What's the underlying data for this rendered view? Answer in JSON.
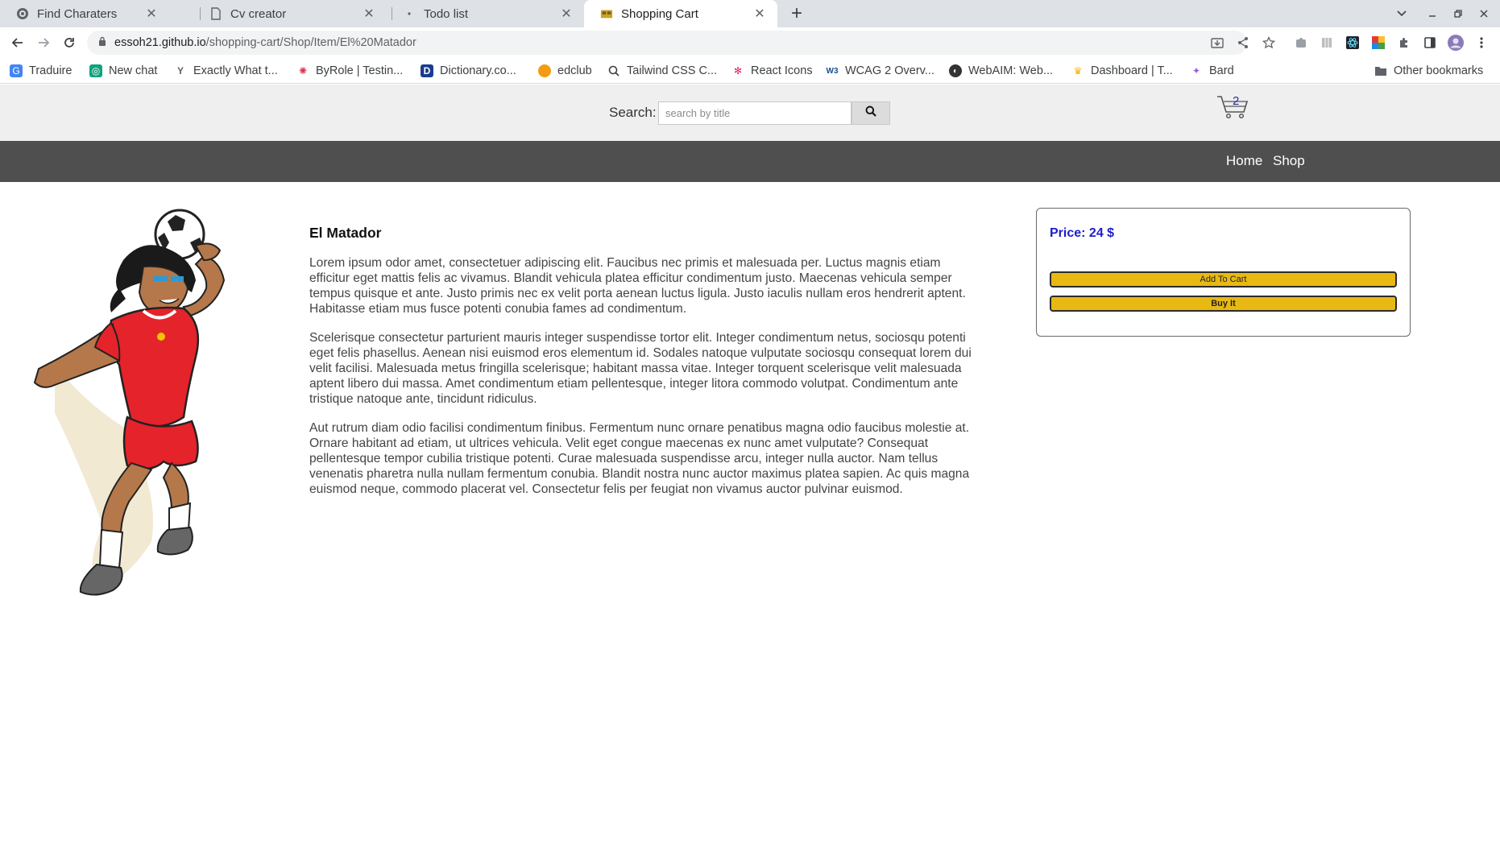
{
  "browser": {
    "tabs": [
      {
        "title": "Find Charaters",
        "icon": "globe-icon",
        "active": false
      },
      {
        "title": "Cv creator",
        "icon": "document-icon",
        "active": false
      },
      {
        "title": "Todo list",
        "icon": "dot-icon",
        "active": false
      },
      {
        "title": "Shopping Cart",
        "icon": "cart-favicon",
        "active": true
      }
    ],
    "url": {
      "host": "essoh21.github.io",
      "path": "/shopping-cart/Shop/Item/El%20Matador"
    },
    "bookmarks": [
      {
        "label": "Traduire",
        "icon": "translate-icon",
        "color": "#4285f4"
      },
      {
        "label": "New chat",
        "icon": "chat-icon",
        "color": "#10a37f"
      },
      {
        "label": "Exactly What t...",
        "icon": "y-icon",
        "color": "#5f6368"
      },
      {
        "label": "ByRole | Testin...",
        "icon": "octopus-icon",
        "color": "#e2334f"
      },
      {
        "label": "Dictionary.co...",
        "icon": "d-icon",
        "color": "#1a3c8f"
      },
      {
        "label": "edclub",
        "icon": "orange-icon",
        "color": "#f39c12"
      },
      {
        "label": "Tailwind CSS C...",
        "icon": "search-icon",
        "color": "#5f6368"
      },
      {
        "label": "React Icons",
        "icon": "react-icon",
        "color": "#e91e63"
      },
      {
        "label": "WCAG 2 Overv...",
        "icon": "w3c-icon",
        "color": "#1a4f8b"
      },
      {
        "label": "WebAIM: Web...",
        "icon": "webaim-icon",
        "color": "#333333"
      },
      {
        "label": "Dashboard | T...",
        "icon": "trophy-icon",
        "color": "#f0b400"
      },
      {
        "label": "Bard",
        "icon": "sparkle-icon",
        "color": "#8e5cf2"
      }
    ],
    "other_bookmarks": "Other bookmarks"
  },
  "header": {
    "search_label": "Search:",
    "search_placeholder": "search by title",
    "cart_count": "2"
  },
  "nav": {
    "home": "Home",
    "shop": "Shop"
  },
  "product": {
    "title": "El Matador",
    "paragraphs": [
      "Lorem ipsum odor amet, consectetuer adipiscing elit. Faucibus nec primis et malesuada per. Luctus magnis etiam efficitur eget mattis felis ac vivamus. Blandit vehicula platea efficitur condimentum justo. Maecenas vehicula semper tempus quisque et ante. Justo primis nec ex velit porta aenean luctus ligula. Justo iaculis nullam eros hendrerit aptent. Habitasse etiam mus fusce potenti conubia fames ad condimentum.",
      "Scelerisque consectetur parturient mauris integer suspendisse tortor elit. Integer condimentum netus, sociosqu potenti eget felis phasellus. Aenean nisi euismod eros elementum id. Sodales natoque vulputate sociosqu consequat lorem dui velit facilisi. Malesuada metus fringilla scelerisque; habitant massa vitae. Integer torquent scelerisque velit malesuada aptent libero dui massa. Amet condimentum etiam pellentesque, integer litora commodo volutpat. Condimentum ante tristique natoque ante, tincidunt ridiculus.",
      "Aut rutrum diam odio facilisi condimentum finibus. Fermentum nunc ornare penatibus magna odio faucibus molestie at. Ornare habitant ad etiam, ut ultrices vehicula. Velit eget congue maecenas ex nunc amet vulputate? Consequat pellentesque tempor cubilia tristique potenti. Curae malesuada suspendisse arcu, integer nulla auctor. Nam tellus venenatis pharetra nulla nullam fermentum conubia. Blandit nostra nunc auctor maximus platea sapien. Ac quis magna euismod neque, commodo placerat vel. Consectetur felis per feugiat non vivamus auctor pulvinar euismod."
    ],
    "price": "Price: 24 $",
    "add_to_cart": "Add To Cart",
    "buy_it": "Buy It"
  },
  "colors": {
    "navbar": "#4f4f4f",
    "search_band": "#efefef",
    "price": "#1c1ccc",
    "button": "#e8b912"
  }
}
